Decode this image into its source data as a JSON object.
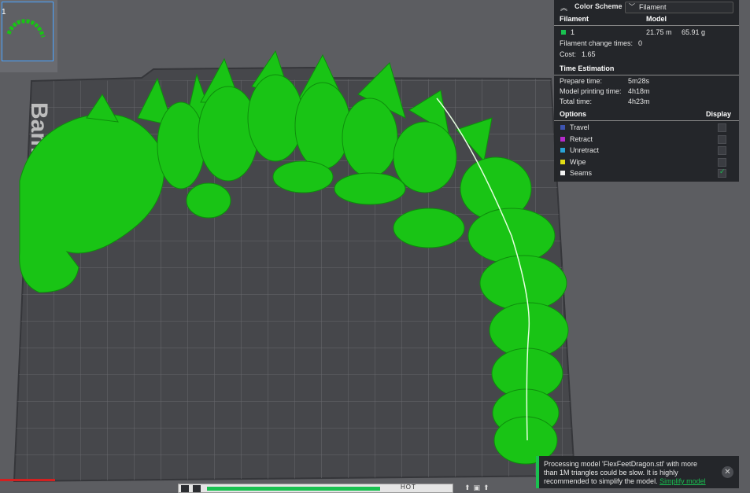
{
  "plate": {
    "label": "Bambu Plate",
    "thumbnail_number": "1",
    "model_color": "#19c415"
  },
  "legend": {
    "color_scheme_label": "Color Scheme",
    "color_scheme_value": "Filament",
    "filament_header": "Filament",
    "model_header": "Model",
    "filament": {
      "id": "1",
      "color": "#19c150",
      "length": "21.75 m",
      "weight": "65.91 g"
    },
    "change_times_label": "Filament change times:",
    "change_times_value": "0",
    "cost_label": "Cost:",
    "cost_value": "1.65",
    "time_header": "Time Estimation",
    "prepare_label": "Prepare time:",
    "prepare_value": "5m28s",
    "printing_label": "Model printing time:",
    "printing_value": "4h18m",
    "total_label": "Total time:",
    "total_value": "4h23m",
    "options_header": "Options",
    "display_header": "Display",
    "options": [
      {
        "label": "Travel",
        "color": "#3d54b0",
        "checked": false
      },
      {
        "label": "Retract",
        "color": "#b62bcc",
        "checked": false
      },
      {
        "label": "Unretract",
        "color": "#2aa3d6",
        "checked": false
      },
      {
        "label": "Wipe",
        "color": "#e3de16",
        "checked": false
      },
      {
        "label": "Seams",
        "color": "#f2f2f2",
        "checked": true
      }
    ]
  },
  "notification": {
    "message": "Processing model 'FlexFeetDragon.stl' with more than 1M triangles could be slow. It is highly recommended to simplify the model.",
    "link_label": "Simplify model"
  },
  "slider": {
    "hot_label": "HOT"
  },
  "icons": {
    "collapse": "chevron-up-icon",
    "dropdown": "chevron-down-icon",
    "close": "close-icon"
  }
}
